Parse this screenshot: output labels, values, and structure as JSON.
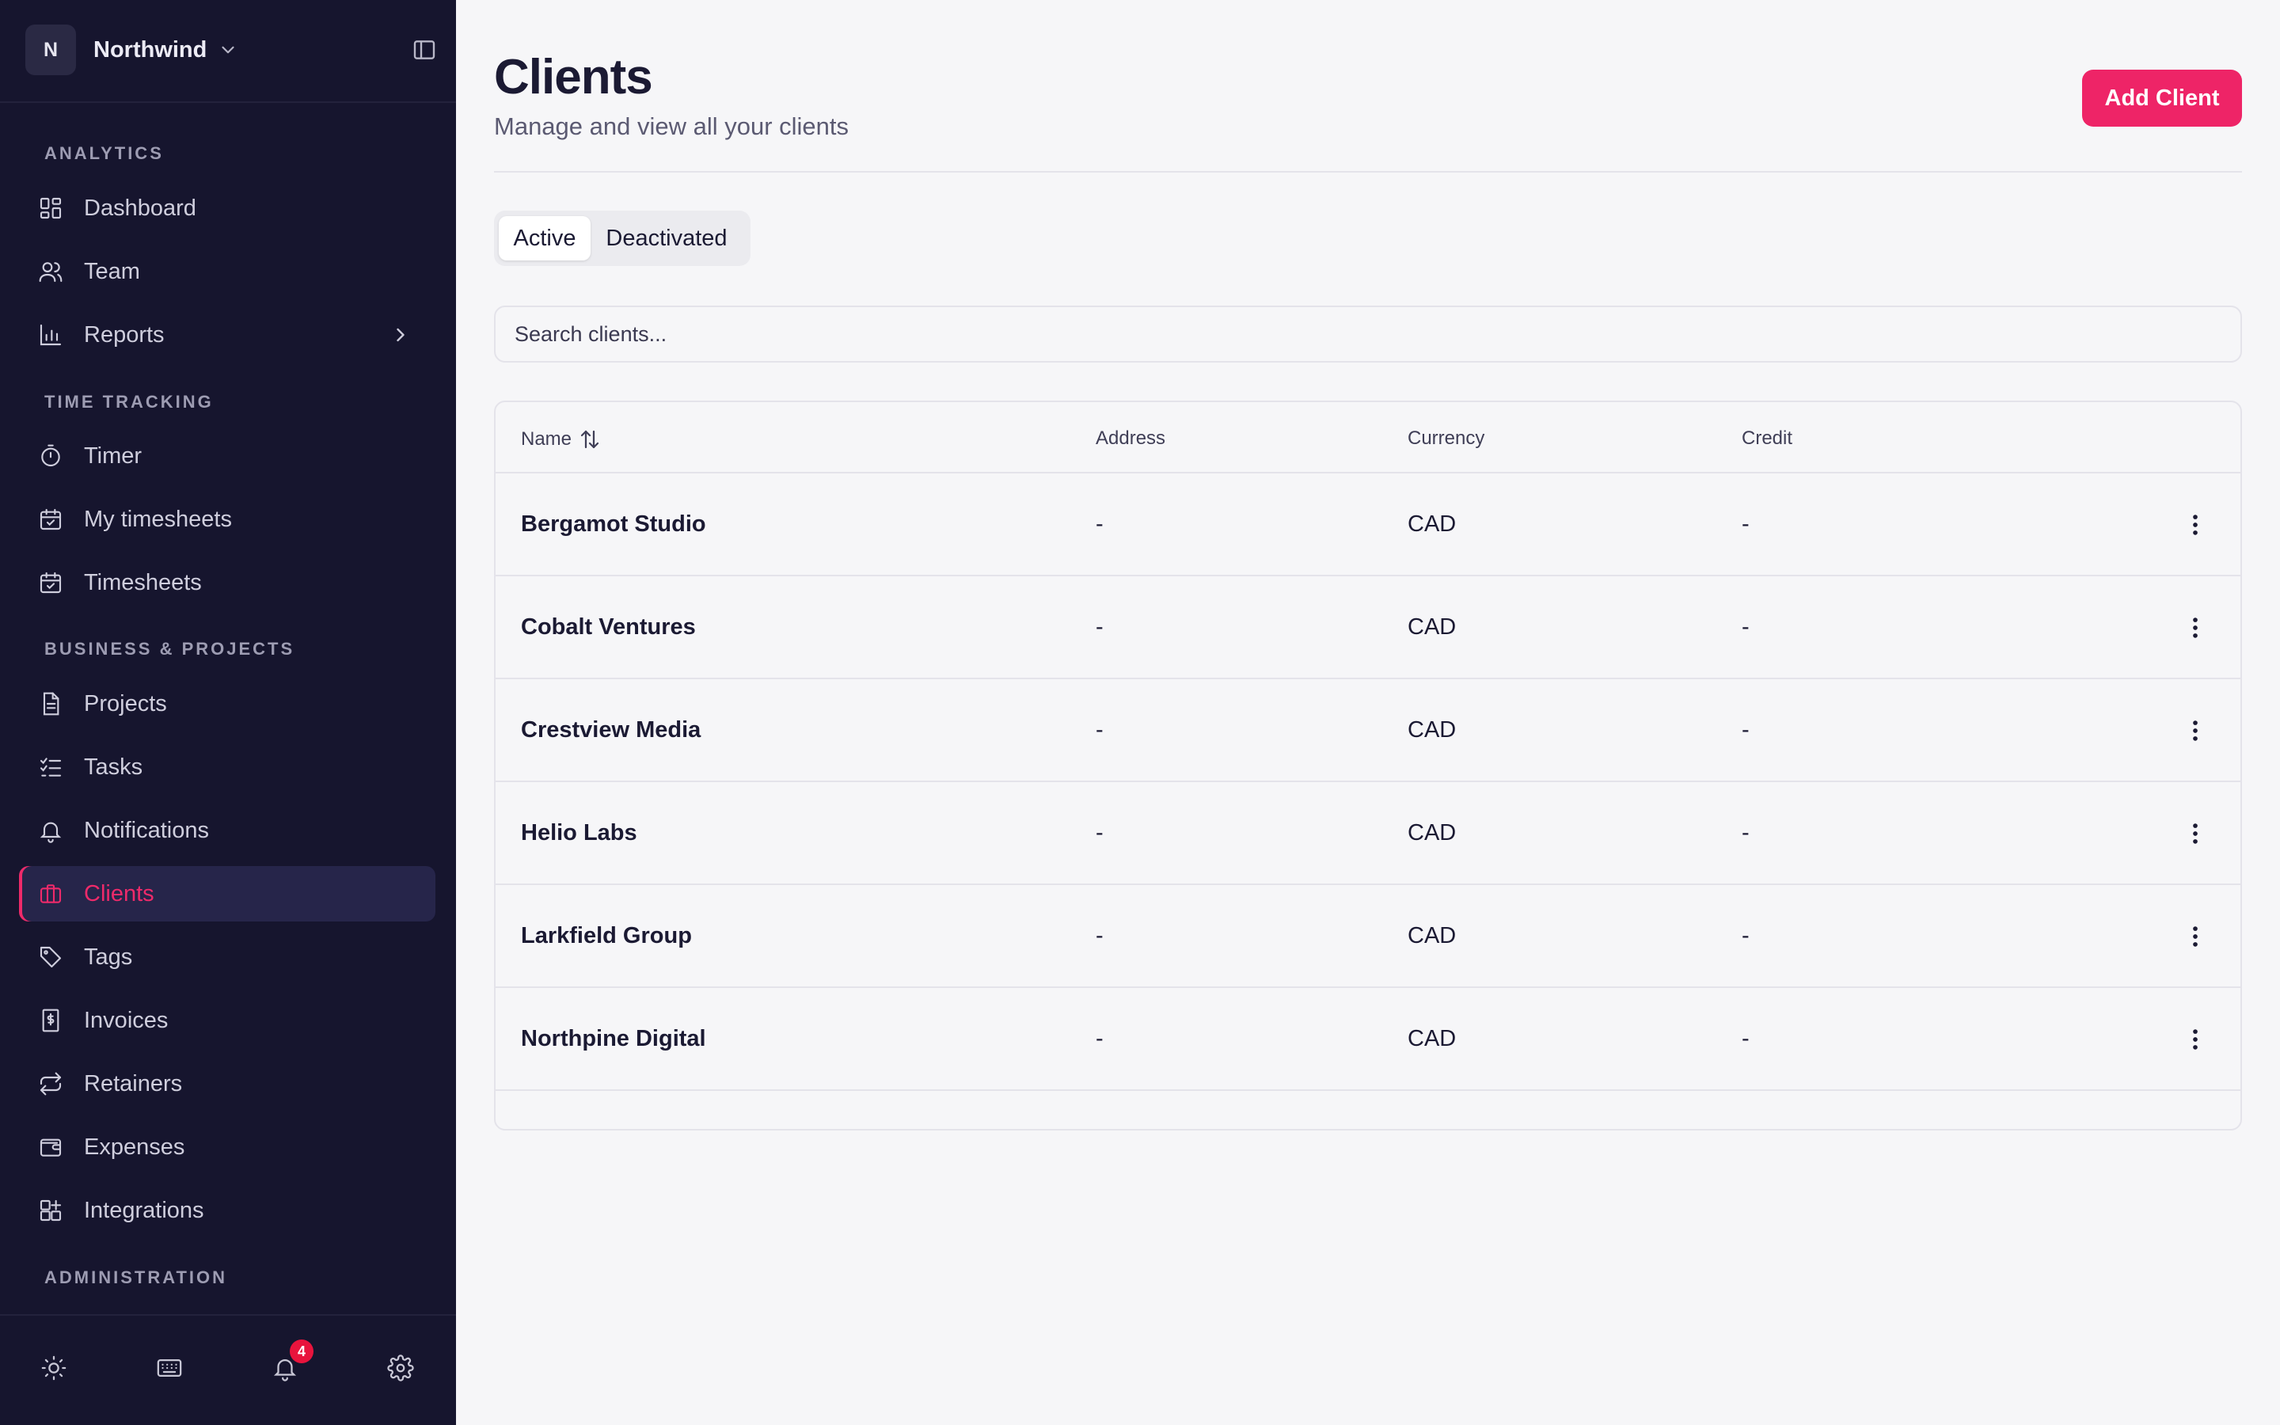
{
  "workspace": {
    "initial": "N",
    "name": "Northwind"
  },
  "sidebar": {
    "sections": [
      {
        "title": "ANALYTICS"
      },
      {
        "title": "TIME TRACKING"
      },
      {
        "title": "BUSINESS & PROJECTS"
      },
      {
        "title": "ADMINISTRATION"
      }
    ],
    "items": {
      "dashboard": "Dashboard",
      "team": "Team",
      "reports": "Reports",
      "timer": "Timer",
      "my_timesheets": "My timesheets",
      "timesheets": "Timesheets",
      "projects": "Projects",
      "tasks": "Tasks",
      "notifications": "Notifications",
      "clients": "Clients",
      "tags": "Tags",
      "invoices": "Invoices",
      "retainers": "Retainers",
      "expenses": "Expenses",
      "integrations": "Integrations"
    },
    "active_item": "clients",
    "notification_count": "4",
    "bottom_icons": [
      "sun-icon",
      "keyboard-icon",
      "bell-icon",
      "gear-icon"
    ]
  },
  "header": {
    "title": "Clients",
    "subtitle": "Manage and view all your clients",
    "add_button": "Add Client"
  },
  "tabs": [
    {
      "label": "Active",
      "selected": true
    },
    {
      "label": "Deactivated",
      "selected": false
    }
  ],
  "search": {
    "placeholder": "Search clients...",
    "value": ""
  },
  "table": {
    "columns": [
      "Name",
      "Address",
      "Currency",
      "Credit"
    ],
    "rows": [
      {
        "name": "Bergamot Studio",
        "address": "-",
        "currency": "CAD",
        "credit": "-"
      },
      {
        "name": "Cobalt Ventures",
        "address": "-",
        "currency": "CAD",
        "credit": "-"
      },
      {
        "name": "Crestview Media",
        "address": "-",
        "currency": "CAD",
        "credit": "-"
      },
      {
        "name": "Helio Labs",
        "address": "-",
        "currency": "CAD",
        "credit": "-"
      },
      {
        "name": "Larkfield Group",
        "address": "-",
        "currency": "CAD",
        "credit": "-"
      },
      {
        "name": "Northpine Digital",
        "address": "-",
        "currency": "CAD",
        "credit": "-"
      }
    ]
  },
  "colors": {
    "sidebar_bg": "#16152e",
    "accent": "#ee2467",
    "page_bg": "#f6f6f8",
    "badge": "#e8143d"
  }
}
